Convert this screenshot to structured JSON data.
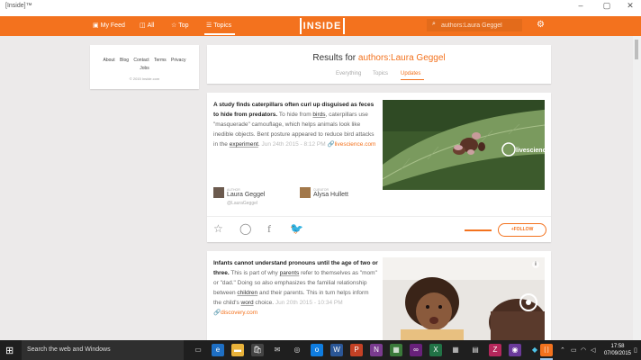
{
  "window": {
    "title": "[Inside]™",
    "controls": {
      "minimize": "–",
      "maximize": "▢",
      "close": "✕"
    }
  },
  "navbar": {
    "items": [
      {
        "label": "My Feed",
        "icon": "feed-icon"
      },
      {
        "label": "All",
        "icon": "cards-icon"
      },
      {
        "label": "Top",
        "icon": "star-icon"
      },
      {
        "label": "Topics",
        "icon": "list-icon",
        "active": true
      }
    ],
    "logo": "INSIDE",
    "search_value": "authors:Laura Geggel",
    "accent_color": "#f3721e"
  },
  "about": {
    "links": [
      "About",
      "Blog",
      "Contact",
      "Terms",
      "Privacy",
      "Jobs"
    ],
    "copyright": "© 2015 Inside.com"
  },
  "results": {
    "prefix": "Results for ",
    "query": "authors:Laura Geggel",
    "tabs": [
      {
        "label": "Everything",
        "active": false
      },
      {
        "label": "Topics",
        "active": false
      },
      {
        "label": "Updates",
        "active": true
      }
    ]
  },
  "stories": [
    {
      "headline": "A study finds caterpillars often curl up disguised as feces to hide from predators.",
      "body_1": " To hide from ",
      "kw_1": "birds",
      "body_2": ", caterpillars use \"masquerade\" camouflage, which helps animals look like inedible objects. Bent posture appeared to reduce bird attacks in the ",
      "kw_2": "experiment",
      "body_3": ". ",
      "date": "Jun 24th 2015 - 8:12 PM",
      "source": "livescience.com",
      "watermark": "livescience",
      "author": {
        "role": "AUTHOR",
        "name": "Laura Geggel",
        "handle": "@LauraGeggel"
      },
      "curator": {
        "role": "CURATOR",
        "name": "Alysa Hullett"
      },
      "follow_label": "+FOLLOW"
    },
    {
      "headline": "Infants cannot understand pronouns until the age of two or three.",
      "body_1": " This is part of why ",
      "kw_1": "parents",
      "body_2": " refer to themselves as \"mom\" or \"dad.\" Doing so also emphasizes the familial relationship between ",
      "kw_2": "children",
      "body_3": " and their parents. This in turn helps inform the child's ",
      "kw_3": "word",
      "body_4": " choice. ",
      "date": "Jun 20th 2015 - 10:34 PM",
      "source": "discovery.com",
      "info": "i"
    }
  ],
  "taskbar": {
    "search_placeholder": "Search the web and Windows",
    "time": "17:58",
    "date": "07/09/2015"
  }
}
